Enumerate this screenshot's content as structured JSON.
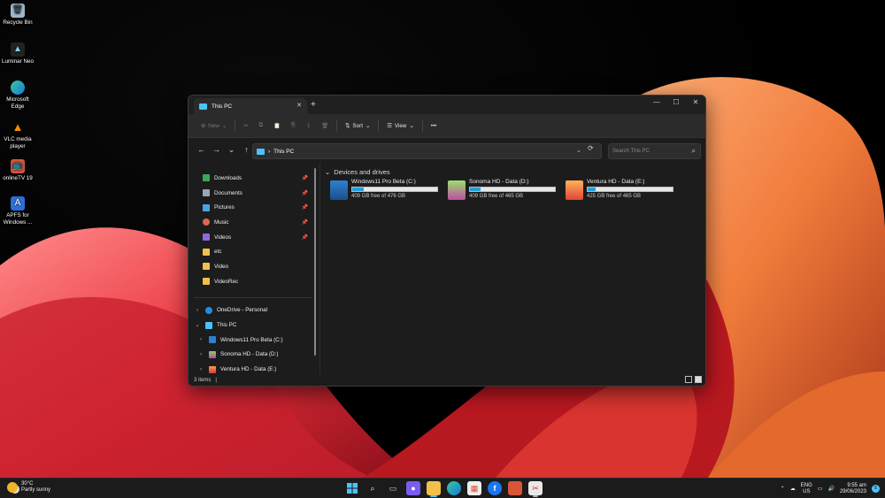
{
  "desktop": {
    "icons": [
      {
        "label": "Recycle Bin",
        "icon": "recycle-bin-icon"
      },
      {
        "label": "Luminar Neo",
        "icon": "luminar-neo-icon"
      },
      {
        "label": "Microsoft Edge",
        "icon": "edge-icon"
      },
      {
        "label": "VLC media player",
        "icon": "vlc-icon"
      },
      {
        "label": "onlineTV 19",
        "icon": "onlinetv-icon"
      },
      {
        "label": "APFS for Windows ...",
        "icon": "apfs-icon"
      }
    ]
  },
  "window": {
    "tab_title": "This PC",
    "tab_close": "✕",
    "new_tab": "+",
    "controls": {
      "minimize": "—",
      "maximize": "☐",
      "close": "✕"
    },
    "toolbar": {
      "new_label": "New",
      "sort_label": "Sort",
      "view_label": "View",
      "more_label": "•••"
    },
    "address": {
      "path_root": "This PC",
      "separator": "›"
    },
    "search": {
      "placeholder": "Search This PC"
    },
    "sidebar": {
      "quick_access": [
        {
          "label": "Downloads",
          "pinned": true,
          "color": "#3aa757"
        },
        {
          "label": "Documents",
          "pinned": true,
          "color": "#9aa7b8"
        },
        {
          "label": "Pictures",
          "pinned": true,
          "color": "#4ba3e3"
        },
        {
          "label": "Music",
          "pinned": true,
          "color": "#e0664f"
        },
        {
          "label": "Videos",
          "pinned": true,
          "color": "#8e6ad8"
        },
        {
          "label": "etc",
          "pinned": false,
          "color": "#f2c04a"
        },
        {
          "label": "Video",
          "pinned": false,
          "color": "#f2c04a"
        },
        {
          "label": "VideoRec",
          "pinned": false,
          "color": "#f2c04a"
        }
      ],
      "onedrive": "OneDrive - Personal",
      "this_pc": "This PC",
      "drives": [
        "Windows11 Pro Beta (C:)",
        "Sonoma HD - Data (D:)",
        "Ventura HD - Data (E:)"
      ]
    },
    "content": {
      "group_title": "Devices and drives",
      "drives": [
        {
          "name": "Windows11 Pro Beta (C:)",
          "free_text": "409 GB free of 476 GB",
          "used_fraction": 0.14
        },
        {
          "name": "Sonoma HD - Data (D:)",
          "free_text": "409 GB free of 465 GB",
          "used_fraction": 0.12
        },
        {
          "name": "Ventura HD - Data (E:)",
          "free_text": "425 GB free of 465 GB",
          "used_fraction": 0.09
        }
      ]
    },
    "status": {
      "items": "3 items",
      "separator": "|"
    }
  },
  "taskbar": {
    "weather": {
      "temp": "30°C",
      "condition": "Partly sunny"
    },
    "apps": [
      {
        "name": "start-icon"
      },
      {
        "name": "search-icon"
      },
      {
        "name": "task-view-icon"
      },
      {
        "name": "teams-chat-icon"
      },
      {
        "name": "file-explorer-icon"
      },
      {
        "name": "edge-icon"
      },
      {
        "name": "store-icon"
      },
      {
        "name": "facebook-icon"
      },
      {
        "name": "onlinetv-icon"
      },
      {
        "name": "snipping-tool-icon"
      }
    ],
    "tray": {
      "lang_top": "ENG",
      "lang_bottom": "US",
      "time": "9:55 am",
      "date": "29/06/2023",
      "notification_count": "5"
    }
  }
}
